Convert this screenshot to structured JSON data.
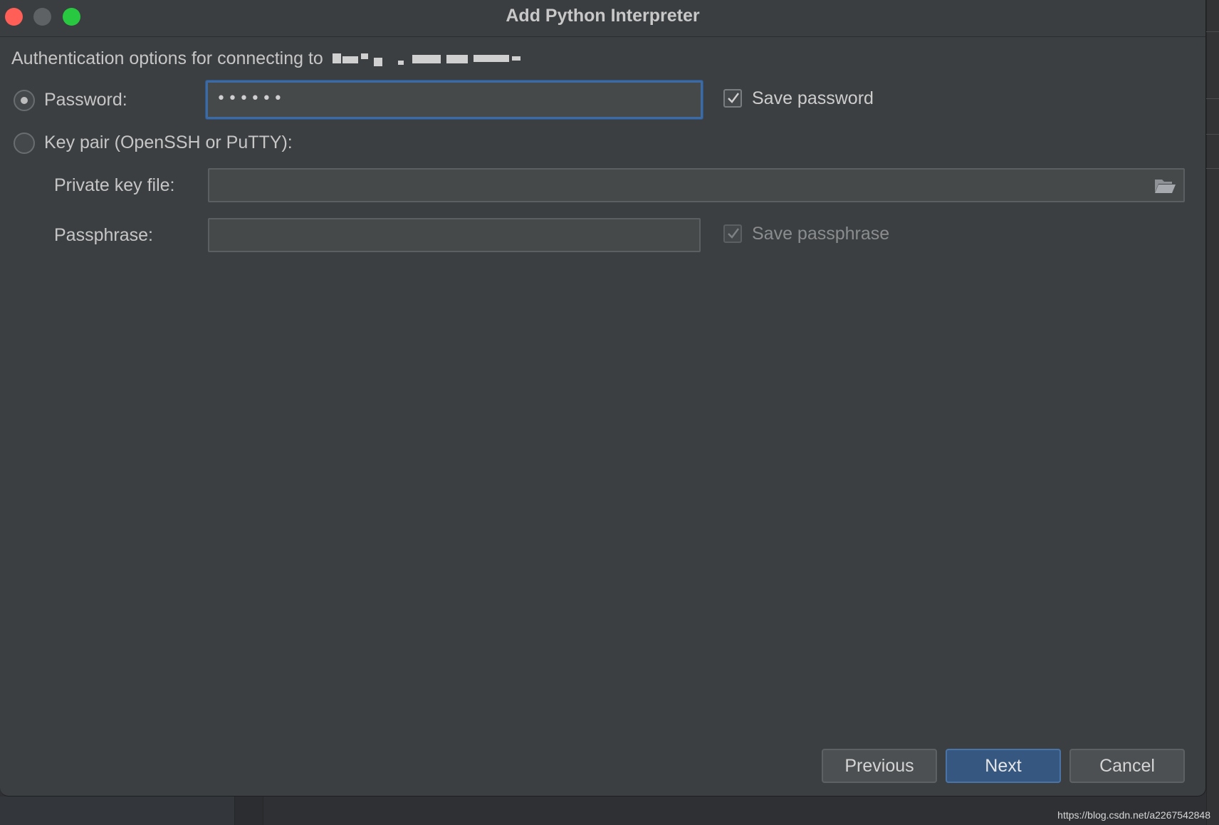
{
  "window": {
    "title": "Add Python Interpreter"
  },
  "auth": {
    "heading": "Authentication options for connecting to",
    "password_option": {
      "label": "Password:",
      "selected": true,
      "value": "••••••",
      "save_label": "Save password",
      "save_checked": true
    },
    "keypair_option": {
      "label": "Key pair (OpenSSH or PuTTY):",
      "selected": false,
      "private_key_label": "Private key file:",
      "private_key_value": "",
      "passphrase_label": "Passphrase:",
      "passphrase_value": "",
      "save_passphrase_label": "Save passphrase",
      "save_passphrase_checked": true,
      "save_passphrase_enabled": false
    }
  },
  "buttons": {
    "previous": "Previous",
    "next": "Next",
    "cancel": "Cancel"
  },
  "watermark": "https://blog.csdn.net/a2267542848",
  "colors": {
    "dialog_bg": "#3c3f41",
    "focus_border": "#3d6aa0",
    "primary_button": "#365880"
  },
  "icons": {
    "browse": "folder-open-icon"
  }
}
